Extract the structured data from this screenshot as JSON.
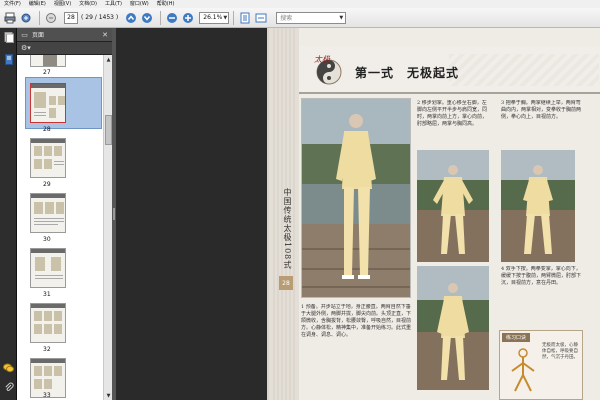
{
  "menubar": {
    "items": [
      "文件(F)",
      "编辑(E)",
      "视图(V)",
      "文档(D)",
      "工具(T)",
      "窗口(W)",
      "帮助(H)"
    ]
  },
  "toolbar": {
    "page_current": "28",
    "page_count": "( 29 / 1453 )",
    "zoom": "26.1%",
    "search_placeholder": "搜索"
  },
  "panel": {
    "title": "页面",
    "thumbnails": [
      {
        "label": "27"
      },
      {
        "label": "28"
      },
      {
        "label": "29"
      },
      {
        "label": "30"
      },
      {
        "label": "31"
      },
      {
        "label": "32"
      },
      {
        "label": "33"
      }
    ]
  },
  "page": {
    "logo_text": "太极",
    "title": "第一式　无极起式",
    "vertical_title": "中国传统太极108式",
    "page_number": "28",
    "text_a": "2 移步划掌。重心移至右脚，左脚向左侧平开半步与肩同宽，同时，两掌向前上方，掌心向前，肘部略屈，两掌与胸同高。",
    "text_b": "3 抱拳于胸。两掌继续上举，两臂弯曲向内，两掌相对，变拳收于胸前两侧，拳心向上，目视前方。",
    "text_main": "1 预备。并步站立于地，身正腰直。两臂自然下垂于大腿外侧，两脚并拢，脚尖向前。头顶正直，下颌微收，含胸拔背，松腰敛臀，呼吸自然，目视前方。心静体松，精神集中，准备开始练习。此式重在调身、调息、调心。",
    "text_c": "4 双手下按。两拳变掌，掌心向下，缓缓下按于腹前，两臂微屈，肘部下沉，目视前方，意在丹田。",
    "practice_title": "练习口诀",
    "practice_text": "无极而太极，心静体自松，呼吸要自然，气沉于丹田。"
  }
}
